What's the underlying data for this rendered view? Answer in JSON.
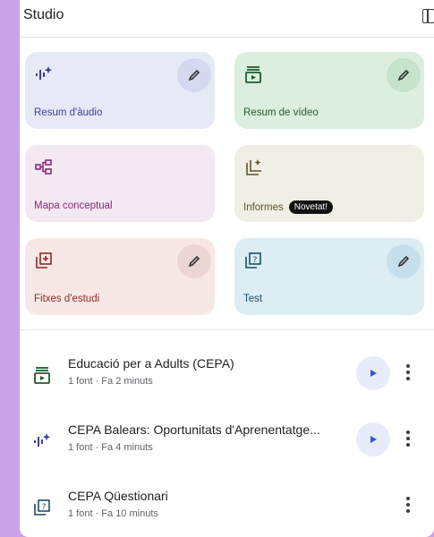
{
  "header": {
    "title": "Studio"
  },
  "cards": [
    {
      "label": "Resum d'àudio",
      "icon": "audio-spark-icon",
      "bg": "#e8e9f7",
      "fg": "#3c3f9a",
      "edit": true
    },
    {
      "label": "Resum de vídeo",
      "icon": "video-icon",
      "bg": "#dcefdf",
      "fg": "#1f5a2f",
      "edit": true
    },
    {
      "label": "Mapa conceptual",
      "icon": "mind-map-icon",
      "bg": "#f4e8f3",
      "fg": "#8a2a74",
      "edit": false
    },
    {
      "label": "Informes",
      "icon": "report-spark-icon",
      "bg": "#f0efe6",
      "fg": "#5c5226",
      "edit": false,
      "badge": "Novetat!"
    },
    {
      "label": "Fitxes d'estudi",
      "icon": "flashcards-icon",
      "bg": "#f7e8e6",
      "fg": "#8a2a2a",
      "edit": true
    },
    {
      "label": "Test",
      "icon": "quiz-icon",
      "bg": "#dcedf4",
      "fg": "#1d4f66",
      "edit": true
    }
  ],
  "items": [
    {
      "title": "Educació per a Adults (CEPA)",
      "meta": "1 font · Fa 2 minuts",
      "icon": "video-icon",
      "playable": true
    },
    {
      "title": "CEPA Balears: Oportunitats d'Aprenentatge...",
      "meta": "1 font · Fa 4 minuts",
      "icon": "audio-spark-icon",
      "playable": true
    },
    {
      "title": "CEPA Qüestionari",
      "meta": "1 font · Fa 10 minuts",
      "icon": "quiz-icon",
      "playable": false
    }
  ],
  "colors": {
    "accent": "#3b55d9",
    "background": "#c9a3e6"
  }
}
